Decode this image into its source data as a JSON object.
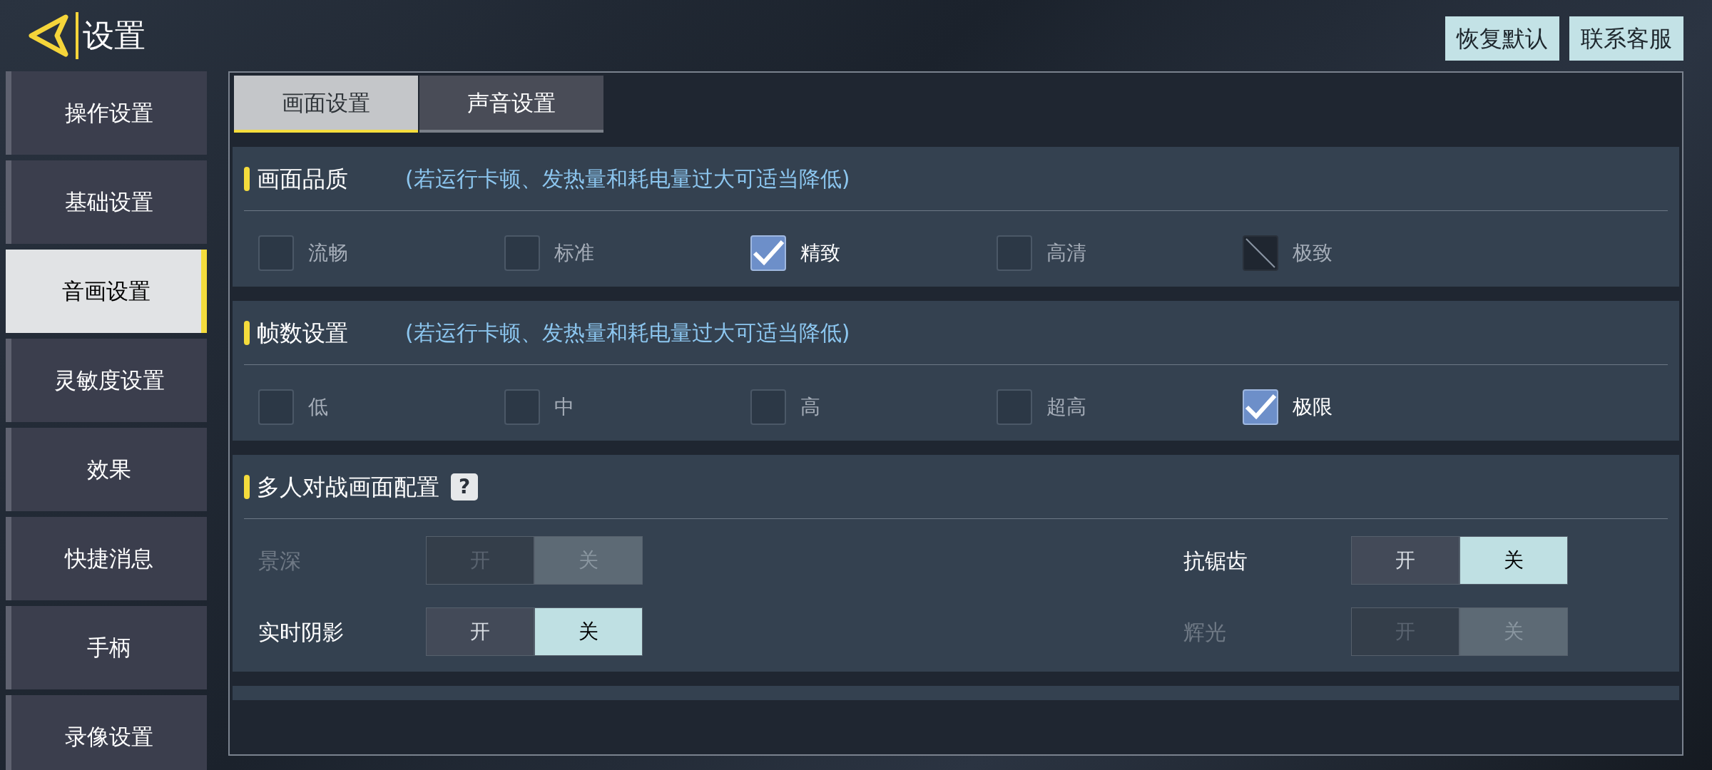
{
  "header": {
    "title": "设置",
    "buttons": [
      "恢复默认",
      "联系客服"
    ]
  },
  "sidebar": {
    "items": [
      {
        "label": "操作设置",
        "selected": false
      },
      {
        "label": "基础设置",
        "selected": false
      },
      {
        "label": "音画设置",
        "selected": true
      },
      {
        "label": "灵敏度设置",
        "selected": false
      },
      {
        "label": "效果",
        "selected": false
      },
      {
        "label": "快捷消息",
        "selected": false
      },
      {
        "label": "手柄",
        "selected": false
      },
      {
        "label": "录像设置",
        "selected": false
      }
    ]
  },
  "tabs": [
    {
      "label": "画面设置",
      "selected": true
    },
    {
      "label": "声音设置",
      "selected": false
    }
  ],
  "sections": [
    {
      "title": "画面品质",
      "hint": "(若运行卡顿、发热量和耗电量过大可适当降低)",
      "kind": "options",
      "options": [
        {
          "label": "流畅",
          "checked": false,
          "disabled": false
        },
        {
          "label": "标准",
          "checked": false,
          "disabled": false
        },
        {
          "label": "精致",
          "checked": true,
          "disabled": false
        },
        {
          "label": "高清",
          "checked": false,
          "disabled": false
        },
        {
          "label": "极致",
          "checked": false,
          "disabled": true
        }
      ]
    },
    {
      "title": "帧数设置",
      "hint": "(若运行卡顿、发热量和耗电量过大可适当降低)",
      "kind": "options",
      "options": [
        {
          "label": "低",
          "checked": false,
          "disabled": false
        },
        {
          "label": "中",
          "checked": false,
          "disabled": false
        },
        {
          "label": "高",
          "checked": false,
          "disabled": false
        },
        {
          "label": "超高",
          "checked": false,
          "disabled": false
        },
        {
          "label": "极限",
          "checked": true,
          "disabled": false
        }
      ]
    },
    {
      "title": "多人对战画面配置",
      "help": "?",
      "kind": "toggles",
      "toggles": [
        {
          "label": "景深",
          "on_label": "开",
          "off_label": "关",
          "on": false,
          "disabled": true
        },
        {
          "label": "抗锯齿",
          "on_label": "开",
          "off_label": "关",
          "on": false,
          "disabled": false
        },
        {
          "label": "实时阴影",
          "on_label": "开",
          "off_label": "关",
          "on": false,
          "disabled": false
        },
        {
          "label": "辉光",
          "on_label": "开",
          "off_label": "关",
          "on": false,
          "disabled": true
        }
      ]
    }
  ]
}
